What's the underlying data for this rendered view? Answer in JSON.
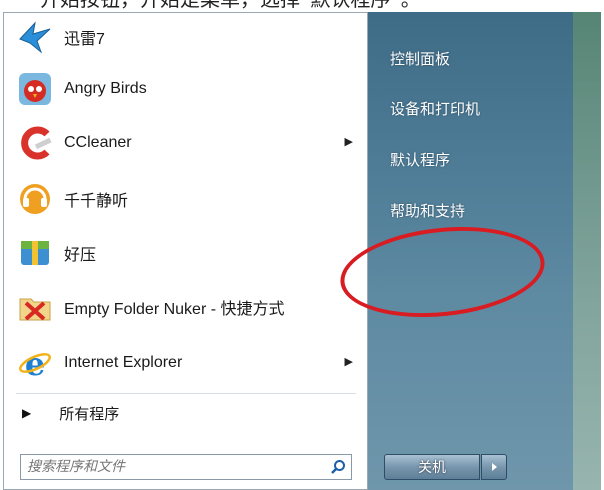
{
  "caption": "开始按钮，开始是菜单，选择“默认程序”。",
  "programs": [
    {
      "label": "迅雷7",
      "icon": "thunder-bird-icon",
      "has_submenu": false
    },
    {
      "label": "Angry Birds",
      "icon": "angry-birds-icon",
      "has_submenu": false
    },
    {
      "label": "CCleaner",
      "icon": "ccleaner-icon",
      "has_submenu": true
    },
    {
      "label": "千千静听",
      "icon": "ttplayer-icon",
      "has_submenu": false
    },
    {
      "label": "好压",
      "icon": "haozip-icon",
      "has_submenu": false
    },
    {
      "label": "Empty Folder Nuker - 快捷方式",
      "icon": "empty-folder-nuker-icon",
      "has_submenu": false
    },
    {
      "label": "Internet Explorer",
      "icon": "internet-explorer-icon",
      "has_submenu": true
    }
  ],
  "all_programs": "所有程序",
  "search": {
    "placeholder": "搜索程序和文件"
  },
  "right_items": [
    "控制面板",
    "设备和打印机",
    "默认程序",
    "帮助和支持"
  ],
  "shutdown_label": "关机",
  "colors": {
    "annotation_circle": "#d81c22",
    "right_panel": "#4d7b95"
  }
}
